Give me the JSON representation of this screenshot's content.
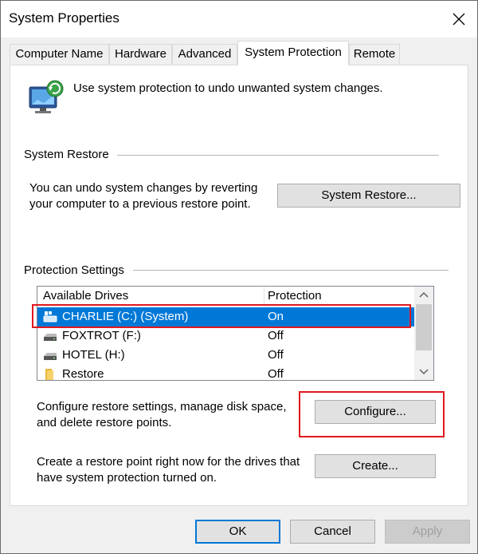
{
  "window": {
    "title": "System Properties"
  },
  "tabs": [
    {
      "label": "Computer Name"
    },
    {
      "label": "Hardware"
    },
    {
      "label": "Advanced"
    },
    {
      "label": "System Protection",
      "active": true
    },
    {
      "label": "Remote"
    }
  ],
  "intro": {
    "text": "Use system protection to undo unwanted system changes."
  },
  "system_restore": {
    "group_label": "System Restore",
    "description_line1": "You can undo system changes by reverting",
    "description_line2": "your computer to a previous restore point.",
    "button_label": "System Restore..."
  },
  "protection": {
    "group_label": "Protection Settings",
    "columns": [
      "Available Drives",
      "Protection"
    ],
    "drives": [
      {
        "name": "CHARLIE (C:) (System)",
        "protection": "On",
        "icon": "system-drive-icon",
        "selected": true
      },
      {
        "name": "FOXTROT (F:)",
        "protection": "Off",
        "icon": "drive-icon"
      },
      {
        "name": "HOTEL (H:)",
        "protection": "Off",
        "icon": "drive-icon"
      },
      {
        "name": "Restore",
        "protection": "Off",
        "icon": "folder-icon"
      }
    ],
    "configure_text_line1": "Configure restore settings, manage disk space,",
    "configure_text_line2": "and delete restore points.",
    "configure_label": "Configure...",
    "create_text_line1": "Create a restore point right now for the drives that",
    "create_text_line2": "have system protection turned on.",
    "create_label": "Create..."
  },
  "footer": {
    "ok_label": "OK",
    "cancel_label": "Cancel",
    "apply_label": "Apply"
  },
  "colors": {
    "selection": "#0078d7",
    "highlight_box": "#e0181e",
    "default_button_border": "#0078d7"
  }
}
